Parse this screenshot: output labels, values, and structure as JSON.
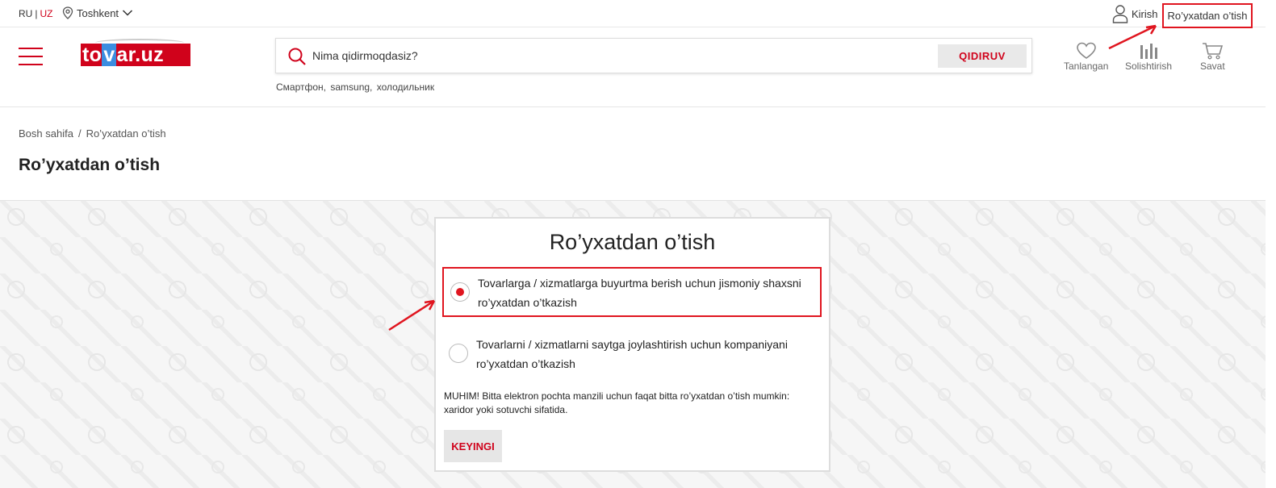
{
  "topbar": {
    "lang_ru": "RU",
    "lang_sep": "|",
    "lang_uz": "UZ",
    "city": "Toshkent",
    "login": "Kirish",
    "register": "Ro’yxatdan o’tish"
  },
  "header": {
    "logo_part1": "to",
    "logo_part2": "v",
    "logo_part3": "ar.uz",
    "search_placeholder": "Nima qidirmoqdasiz?",
    "search_button": "QIDIRUV",
    "hints": [
      "Смартфон,",
      "samsung,",
      "холодильник"
    ],
    "favorites": "Tanlangan",
    "compare": "Solishtirish",
    "cart": "Savat"
  },
  "breadcrumb": {
    "home": "Bosh sahifa",
    "sep": "/",
    "current": "Ro’yxatdan o’tish"
  },
  "page_title": "Ro’yxatdan o’tish",
  "form": {
    "title": "Ro’yxatdan o’tish",
    "options": [
      {
        "label": "Tovarlarga / xizmatlarga buyurtma berish uchun jismoniy shaxsni ro’yxatdan o’tkazish",
        "selected": true
      },
      {
        "label": "Tovarlarni / xizmatlarni saytga joylashtirish uchun kompaniyani ro’yxatdan o’tkazish",
        "selected": false
      }
    ],
    "notice": "MUHIM! Bitta elektron pochta manzili uchun faqat bitta ro’yxatdan o’tish mumkin: xaridor yoki sotuvchi sifatida.",
    "next_button": "KEYINGI"
  },
  "colors": {
    "brand_red": "#d0021b",
    "highlight_red": "#e0151f",
    "logo_blue": "#3b8de0"
  },
  "icons": [
    "location-pin-icon",
    "chevron-down-icon",
    "user-icon",
    "menu-icon",
    "search-icon",
    "heart-icon",
    "compare-icon",
    "cart-icon"
  ]
}
